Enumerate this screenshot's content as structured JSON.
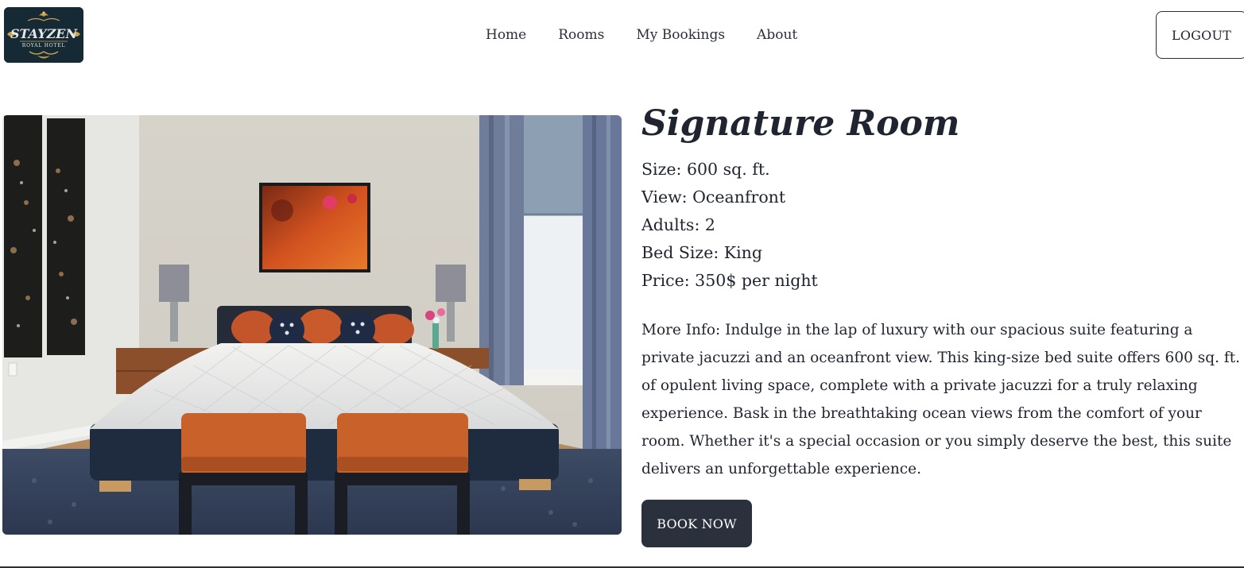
{
  "header": {
    "logo": {
      "brand": "STAYZEN",
      "subtitle": "ROYAL HOTEL"
    },
    "nav": [
      {
        "label": "Home"
      },
      {
        "label": "Rooms"
      },
      {
        "label": "My Bookings"
      },
      {
        "label": "About"
      }
    ],
    "logout_label": "LOGOUT"
  },
  "room": {
    "title": "Signature Room",
    "specs": [
      "Size: 600 sq. ft.",
      "View: Oceanfront",
      "Adults: 2",
      "Bed Size: King",
      "Price: 350$ per night"
    ],
    "more_info": "More Info: Indulge in the lap of luxury with our spacious suite featuring a private jacuzzi and an oceanfront view. This king-size bed suite offers 600 sq. ft. of opulent living space, complete with a private jacuzzi for a truly relaxing experience. Bask in the breathtaking ocean views from the comfort of your room. Whether it's a special occasion or you simply deserve the best, this suite delivers an unforgettable experience.",
    "book_label": "BOOK NOW"
  },
  "colors": {
    "logo_bg": "#162a36",
    "logo_gold": "#c9a24a",
    "book_button_bg": "#2b303d",
    "text": "#1f2430"
  }
}
